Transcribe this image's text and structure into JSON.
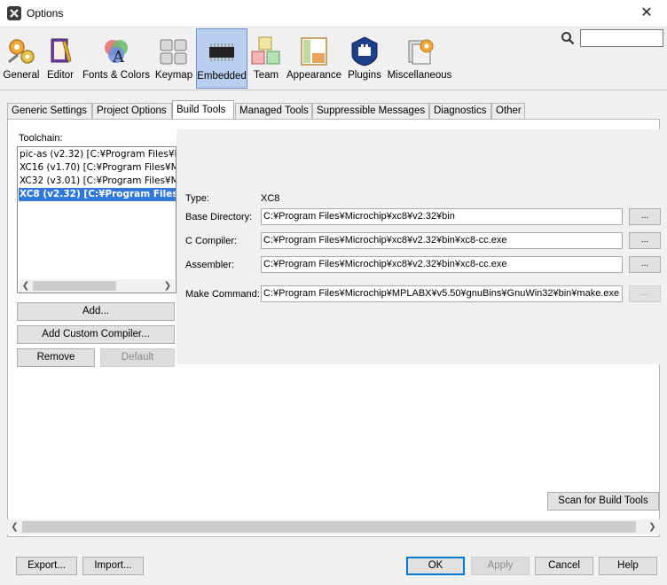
{
  "window": {
    "title": "Options",
    "close_label": "✕"
  },
  "categories": [
    {
      "label": "General",
      "icon": "gears-icon"
    },
    {
      "label": "Editor",
      "icon": "editor-icon"
    },
    {
      "label": "Fonts & Colors",
      "icon": "fonts-colors-icon"
    },
    {
      "label": "Keymap",
      "icon": "keyboard-icon"
    },
    {
      "label": "Embedded",
      "icon": "chip-icon",
      "active": true
    },
    {
      "label": "Team",
      "icon": "team-icon"
    },
    {
      "label": "Appearance",
      "icon": "appearance-icon"
    },
    {
      "label": "Plugins",
      "icon": "plugin-icon"
    },
    {
      "label": "Miscellaneous",
      "icon": "misc-icon"
    }
  ],
  "search": {
    "value": ""
  },
  "tabs": [
    {
      "label": "Generic Settings"
    },
    {
      "label": "Project Options"
    },
    {
      "label": "Build Tools",
      "active": true
    },
    {
      "label": "Managed Tools"
    },
    {
      "label": "Suppressible Messages"
    },
    {
      "label": "Diagnostics"
    },
    {
      "label": "Other"
    }
  ],
  "toolchain": {
    "label": "Toolchain:",
    "items": [
      "pic-as (v2.32) [C:¥Program Files¥M",
      "XC16 (v1.70) [C:¥Program Files¥Mi",
      "XC32 (v3.01) [C:¥Program Files¥Mi",
      "XC8 (v2.32) [C:¥Program Files"
    ],
    "selected_index": 3,
    "buttons": {
      "add": "Add...",
      "add_custom": "Add Custom Compiler...",
      "remove": "Remove",
      "default": "Default"
    }
  },
  "details": {
    "type_label": "Type:",
    "type_value": "XC8",
    "base_dir_label": "Base Directory:",
    "base_dir_value": "C:¥Program Files¥Microchip¥xc8¥v2.32¥bin",
    "c_compiler_label": "C Compiler:",
    "c_compiler_value": "C:¥Program Files¥Microchip¥xc8¥v2.32¥bin¥xc8-cc.exe",
    "assembler_label": "Assembler:",
    "assembler_value": "C:¥Program Files¥Microchip¥xc8¥v2.32¥bin¥xc8-cc.exe",
    "make_label": "Make Command:",
    "make_value": "C:¥Program Files¥Microchip¥MPLABX¥v5.50¥gnuBins¥GnuWin32¥bin¥make.exe",
    "browse_label": "..."
  },
  "scan_button": "Scan for Build Tools",
  "footer": {
    "export": "Export...",
    "import": "Import...",
    "ok": "OK",
    "apply": "Apply",
    "cancel": "Cancel",
    "help": "Help"
  }
}
